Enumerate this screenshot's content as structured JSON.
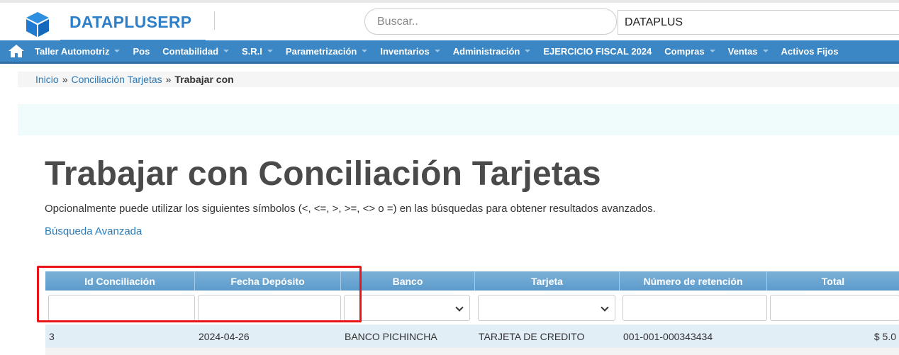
{
  "header": {
    "brand": "DATAPLUSERP",
    "search_placeholder": "Buscar..",
    "company_value": "DATAPLUS"
  },
  "nav": {
    "items": [
      {
        "label": "Taller Automotriz",
        "caret": true
      },
      {
        "label": "Pos",
        "caret": false
      },
      {
        "label": "Contabilidad",
        "caret": true
      },
      {
        "label": "S.R.I",
        "caret": true
      },
      {
        "label": "Parametrización",
        "caret": true
      },
      {
        "label": "Inventarios",
        "caret": true
      },
      {
        "label": "Administración",
        "caret": true
      },
      {
        "label": "EJERCICIO FISCAL 2024",
        "caret": false
      },
      {
        "label": "Compras",
        "caret": true
      },
      {
        "label": "Ventas",
        "caret": true
      },
      {
        "label": "Activos Fijos",
        "caret": false
      }
    ]
  },
  "breadcrumb": {
    "home": "Inicio",
    "sep1": "»",
    "section": "Conciliación Tarjetas",
    "sep2": "»",
    "current": "Trabajar con"
  },
  "page": {
    "title": "Trabajar con Conciliación Tarjetas",
    "hint": "Opcionalmente puede utilizar los siguientes símbolos (<, <=, >, >=, <> o =) en las búsquedas para obtener resultados avanzados.",
    "advanced_link": "Búsqueda Avanzada"
  },
  "table": {
    "columns": [
      "Id Conciliación",
      "Fecha Depósito",
      "Banco",
      "Tarjeta",
      "Número de retención",
      "Total"
    ],
    "rows": [
      [
        "3",
        "2024-04-26",
        "BANCO PICHINCHA",
        "TARJETA DE CREDITO",
        "001-001-000343434",
        "$ 5.0"
      ]
    ]
  },
  "colors": {
    "brand": "#2e7fc8",
    "nav_bg": "#3b86c4",
    "table_header": "#6aa5d1",
    "highlight": "#e8141a"
  }
}
